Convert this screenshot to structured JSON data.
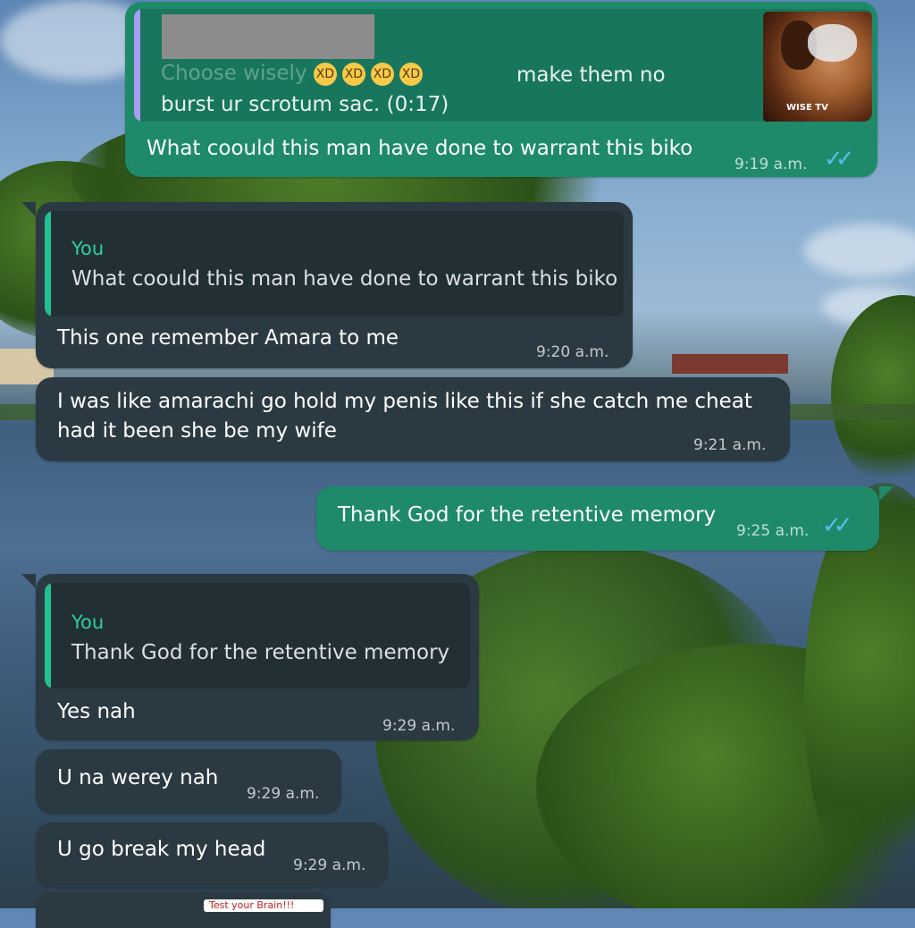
{
  "thread": {
    "first_message": {
      "reply_caption": "make them no burst ur scrotum sac. (0:17)",
      "reply_caption_prefix": "Choose wisely",
      "reply_emoji": [
        "🤣",
        "🤣",
        "🤣",
        "🤣"
      ],
      "thumbnail_watermark": "WISE TV",
      "text": "What coould this man have done to warrant this biko",
      "time": "9:19 a.m."
    },
    "second_message": {
      "quote_author": "You",
      "quote_text": "What coould this man have done to warrant this biko",
      "text": "This one remember Amara to me",
      "time": "9:20 a.m."
    },
    "third_message": {
      "line1": "I was like amarachi go hold my penis like this if she catch me cheat",
      "line2": "had it been she be my wife",
      "time": "9:21 a.m."
    },
    "fourth_message": {
      "text": "Thank God for the retentive memory",
      "time": "9:25 a.m."
    },
    "fifth_message": {
      "quote_author": "You",
      "quote_text": "Thank God for the retentive memory",
      "text": "Yes nah",
      "time": "9:29 a.m."
    },
    "sixth_message": {
      "text": "U na werey nah",
      "time": "9:29 a.m."
    },
    "seventh_message": {
      "text": "U go break my head",
      "time": "9:29 a.m."
    },
    "next_preview_text": "Test your Brain!!!",
    "read_ticks": "✓✓"
  },
  "colors": {
    "incoming_bubble": "#2b3a42",
    "outgoing_bubble": "#1e8a6a",
    "quote_accent": "#21c08f",
    "read_ticks": "#53bdeb"
  }
}
